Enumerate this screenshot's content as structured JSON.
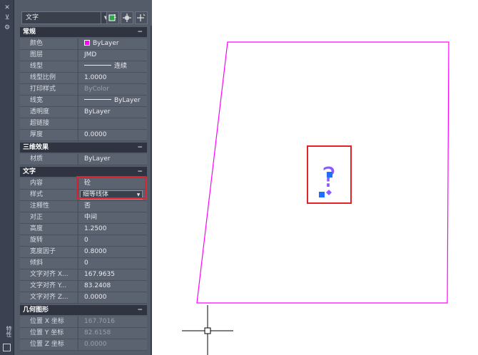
{
  "side_strip": {
    "buttons": [
      "✕",
      "⊻",
      "⚙"
    ],
    "vertical_title": "特性"
  },
  "palette": {
    "object_type": "文字",
    "toolbar_buttons": [
      {
        "icon": "toggle-pickadd-icon"
      },
      {
        "icon": "select-objects-icon"
      },
      {
        "icon": "quick-select-icon"
      }
    ],
    "categories": [
      {
        "title": "常规",
        "toggle": "−",
        "rows": [
          {
            "label": "颜色",
            "value": "ByLayer",
            "swatch": "#ff00ff"
          },
          {
            "label": "图层",
            "value": "JMD"
          },
          {
            "label": "线型",
            "value": "连续",
            "line": true
          },
          {
            "label": "线型比例",
            "value": "1.0000"
          },
          {
            "label": "打印样式",
            "value": "ByColor",
            "dim": true
          },
          {
            "label": "线宽",
            "value": "ByLayer",
            "line": true
          },
          {
            "label": "透明度",
            "value": "ByLayer"
          },
          {
            "label": "超链接",
            "value": ""
          },
          {
            "label": "厚度",
            "value": "0.0000"
          }
        ]
      },
      {
        "title": "三维效果",
        "toggle": "−",
        "rows": [
          {
            "label": "材质",
            "value": "ByLayer"
          }
        ]
      },
      {
        "title": "文字",
        "toggle": "−",
        "rows": [
          {
            "label": "内容",
            "value": "砼"
          },
          {
            "label": "样式",
            "value": "细等线体",
            "dropdown": true
          },
          {
            "label": "注释性",
            "value": "否"
          },
          {
            "label": "对正",
            "value": "中间"
          },
          {
            "label": "高度",
            "value": "1.2500"
          },
          {
            "label": "旋转",
            "value": "0"
          },
          {
            "label": "宽度因子",
            "value": "0.8000"
          },
          {
            "label": "倾斜",
            "value": "0"
          },
          {
            "label": "文字对齐 X...",
            "value": "167.9635"
          },
          {
            "label": "文字对齐 Y...",
            "value": "83.2408"
          },
          {
            "label": "文字对齐 Z...",
            "value": "0.0000"
          }
        ]
      },
      {
        "title": "几何图形",
        "toggle": "−",
        "rows": [
          {
            "label": "位置 X 坐标",
            "value": "167.7016",
            "dim": true
          },
          {
            "label": "位置 Y 坐标",
            "value": "82.6158",
            "dim": true
          },
          {
            "label": "位置 Z 坐标",
            "value": "0.0000",
            "dim": true
          }
        ]
      }
    ]
  },
  "canvas": {
    "text_glyph": "?",
    "colors": {
      "outline": "#ff00ff",
      "text": "#8a5bff",
      "grip": "#1e6fff",
      "highlight": "#e0232b",
      "crosshair": "#000000"
    }
  }
}
